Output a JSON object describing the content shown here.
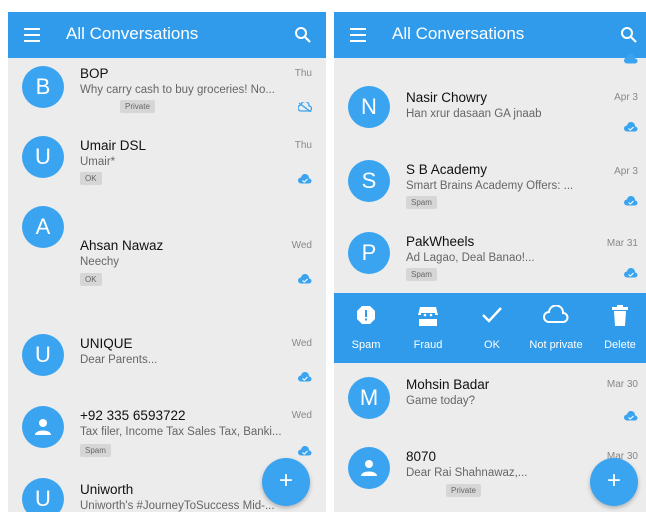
{
  "left": {
    "appbar": {
      "title": "All Conversations"
    },
    "conversations": [
      {
        "avatar": "B",
        "name": "BOP",
        "snippet": "Why carry cash to buy groceries! No...",
        "tag": "Private",
        "date": "Thu",
        "cloud": "cloud-off-icon"
      },
      {
        "avatar": "U",
        "name": "Umair DSL",
        "snippet": "Umair*",
        "tag": "OK",
        "date": "Thu",
        "cloud": "cloud-done-icon"
      },
      {
        "avatar": "A",
        "name": "Ahsan Nawaz",
        "snippet": "Neechy",
        "tag": "OK",
        "date": "Wed",
        "cloud": "cloud-done-icon"
      },
      {
        "avatar": "U",
        "name": "UNIQUE",
        "snippet": "Dear Parents...",
        "tag": "",
        "date": "Wed",
        "cloud": "cloud-done-icon"
      },
      {
        "avatar": "person-icon",
        "name": "+92 335 6593722",
        "snippet": "Tax filer, Income Tax Sales Tax, Banki...",
        "tag": "Spam",
        "date": "Wed",
        "cloud": "cloud-done-icon"
      },
      {
        "avatar": "U",
        "name": "Uniworth",
        "snippet": "Uniworth's #JourneyToSuccess Mid-...",
        "tag": "",
        "date": "",
        "cloud": ""
      }
    ],
    "fab": "+"
  },
  "right": {
    "appbar": {
      "title": "All Conversations"
    },
    "conversations": [
      {
        "avatar": "N",
        "name": "Nasir Chowry",
        "snippet": "Han xrur dasaan GA jnaab",
        "tag": "",
        "date": "Apr 3",
        "cloud": "cloud-done-icon"
      },
      {
        "avatar": "S",
        "name": "S B Academy",
        "snippet": "Smart Brains Academy Offers: ...",
        "tag": "Spam",
        "date": "Apr 3",
        "cloud": "cloud-done-icon"
      },
      {
        "avatar": "P",
        "name": "PakWheels",
        "snippet": "Ad Lagao, Deal Banao!...",
        "tag": "Spam",
        "date": "Mar 31",
        "cloud": "cloud-done-icon"
      },
      {
        "avatar": "M",
        "name": "Mohsin Badar",
        "snippet": "Game today?",
        "tag": "",
        "date": "Mar 30",
        "cloud": "cloud-done-icon"
      },
      {
        "avatar": "person-icon",
        "name": "8070",
        "snippet": "Dear Rai Shahnawaz,...",
        "tag": "Private",
        "date": "Mar 30",
        "cloud": ""
      }
    ],
    "actions": [
      {
        "label": "Spam",
        "icon": "spam-octagon-icon"
      },
      {
        "label": "Fraud",
        "icon": "fraud-thief-icon"
      },
      {
        "label": "OK",
        "icon": "check-icon"
      },
      {
        "label": "Not private",
        "icon": "cloud-outline-icon"
      },
      {
        "label": "Delete",
        "icon": "trash-icon"
      }
    ],
    "fab": "+"
  },
  "colors": {
    "accent": "#2f9bea",
    "avatar": "#3aa4f0",
    "background": "#ececec"
  }
}
